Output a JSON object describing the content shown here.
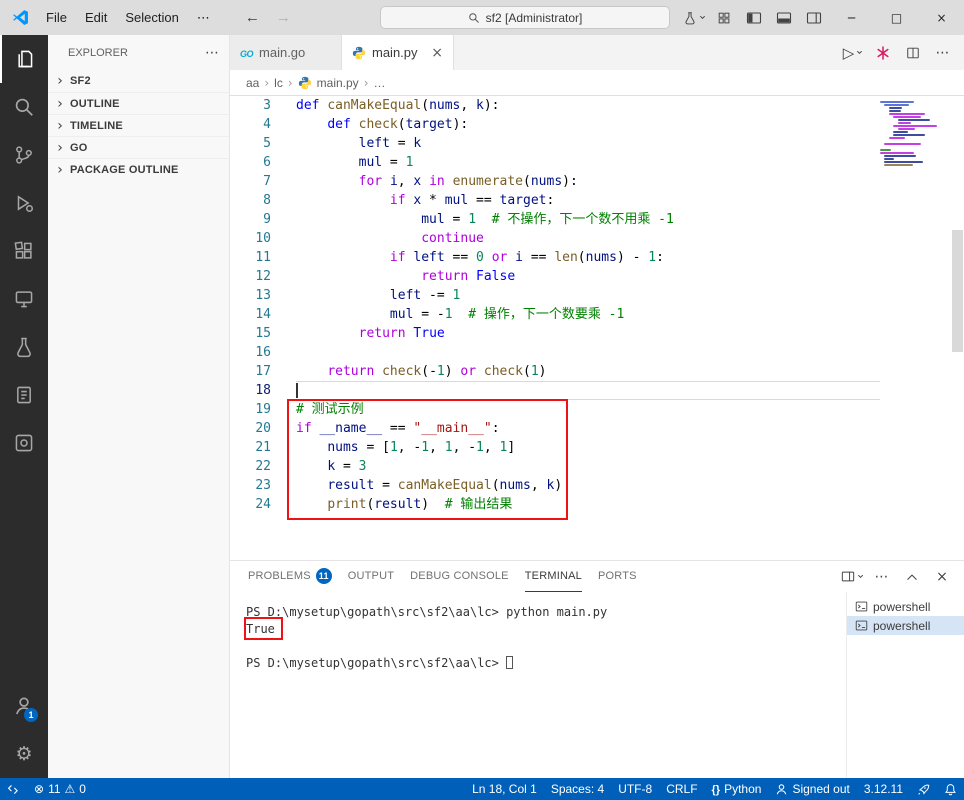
{
  "titlebar": {
    "menus": [
      "File",
      "Edit",
      "Selection"
    ],
    "menu_overflow": "⋯",
    "search_placeholder": "sf2 [Administrator]",
    "window_controls": {
      "minimize": "─",
      "maximize": "□",
      "close": "×"
    }
  },
  "activitybar": {
    "items": [
      "explorer",
      "search",
      "source-control",
      "run-debug",
      "extensions",
      "remote-explorer",
      "testing",
      "notebook",
      "tools"
    ],
    "active_item": "explorer",
    "account_badge": "1"
  },
  "sidebar": {
    "title": "EXPLORER",
    "sections": [
      "SF2",
      "OUTLINE",
      "TIMELINE",
      "GO",
      "PACKAGE OUTLINE"
    ]
  },
  "editor": {
    "tabs": [
      {
        "label": "main.go",
        "icon": "go",
        "active": false
      },
      {
        "label": "main.py",
        "icon": "python",
        "active": true
      }
    ],
    "breadcrumb": [
      "aa",
      "lc",
      "main.py",
      "…"
    ],
    "current_line": 18,
    "lines": [
      {
        "n": 3,
        "tokens": [
          [
            "kw",
            "def"
          ],
          [
            "pl",
            " "
          ],
          [
            "fn",
            "canMakeEqual"
          ],
          [
            "pl",
            "("
          ],
          [
            "var",
            "nums"
          ],
          [
            "pl",
            ", "
          ],
          [
            "var",
            "k"
          ],
          [
            "pl",
            "):"
          ]
        ]
      },
      {
        "n": 4,
        "tokens": [
          [
            "pl",
            "    "
          ],
          [
            "kw",
            "def"
          ],
          [
            "pl",
            " "
          ],
          [
            "fn",
            "check"
          ],
          [
            "pl",
            "("
          ],
          [
            "var",
            "target"
          ],
          [
            "pl",
            "):"
          ]
        ]
      },
      {
        "n": 5,
        "tokens": [
          [
            "pl",
            "        "
          ],
          [
            "var",
            "left"
          ],
          [
            "pl",
            " = "
          ],
          [
            "var",
            "k"
          ]
        ]
      },
      {
        "n": 6,
        "tokens": [
          [
            "pl",
            "        "
          ],
          [
            "var",
            "mul"
          ],
          [
            "pl",
            " = "
          ],
          [
            "num",
            "1"
          ]
        ]
      },
      {
        "n": 7,
        "tokens": [
          [
            "pl",
            "        "
          ],
          [
            "ctrl",
            "for"
          ],
          [
            "pl",
            " "
          ],
          [
            "var",
            "i"
          ],
          [
            "pl",
            ", "
          ],
          [
            "var",
            "x"
          ],
          [
            "pl",
            " "
          ],
          [
            "ctrl",
            "in"
          ],
          [
            "pl",
            " "
          ],
          [
            "fn",
            "enumerate"
          ],
          [
            "pl",
            "("
          ],
          [
            "var",
            "nums"
          ],
          [
            "pl",
            "):"
          ]
        ]
      },
      {
        "n": 8,
        "tokens": [
          [
            "pl",
            "            "
          ],
          [
            "ctrl",
            "if"
          ],
          [
            "pl",
            " "
          ],
          [
            "var",
            "x"
          ],
          [
            "pl",
            " * "
          ],
          [
            "var",
            "mul"
          ],
          [
            "pl",
            " == "
          ],
          [
            "var",
            "target"
          ],
          [
            "pl",
            ":"
          ]
        ]
      },
      {
        "n": 9,
        "tokens": [
          [
            "pl",
            "                "
          ],
          [
            "var",
            "mul"
          ],
          [
            "pl",
            " = "
          ],
          [
            "num",
            "1"
          ],
          [
            "pl",
            "  "
          ],
          [
            "cmt",
            "# 不操作，下一个数不用乘 -1"
          ]
        ]
      },
      {
        "n": 10,
        "tokens": [
          [
            "pl",
            "                "
          ],
          [
            "ctrl",
            "continue"
          ]
        ]
      },
      {
        "n": 11,
        "tokens": [
          [
            "pl",
            "            "
          ],
          [
            "ctrl",
            "if"
          ],
          [
            "pl",
            " "
          ],
          [
            "var",
            "left"
          ],
          [
            "pl",
            " == "
          ],
          [
            "num",
            "0"
          ],
          [
            "pl",
            " "
          ],
          [
            "ctrl",
            "or"
          ],
          [
            "pl",
            " "
          ],
          [
            "var",
            "i"
          ],
          [
            "pl",
            " == "
          ],
          [
            "fn",
            "len"
          ],
          [
            "pl",
            "("
          ],
          [
            "var",
            "nums"
          ],
          [
            "pl",
            ") - "
          ],
          [
            "num",
            "1"
          ],
          [
            "pl",
            ":"
          ]
        ]
      },
      {
        "n": 12,
        "tokens": [
          [
            "pl",
            "                "
          ],
          [
            "ctrl",
            "return"
          ],
          [
            "pl",
            " "
          ],
          [
            "kw",
            "False"
          ]
        ]
      },
      {
        "n": 13,
        "tokens": [
          [
            "pl",
            "            "
          ],
          [
            "var",
            "left"
          ],
          [
            "pl",
            " -= "
          ],
          [
            "num",
            "1"
          ]
        ]
      },
      {
        "n": 14,
        "tokens": [
          [
            "pl",
            "            "
          ],
          [
            "var",
            "mul"
          ],
          [
            "pl",
            " = -"
          ],
          [
            "num",
            "1"
          ],
          [
            "pl",
            "  "
          ],
          [
            "cmt",
            "# 操作，下一个数要乘 -1"
          ]
        ]
      },
      {
        "n": 15,
        "tokens": [
          [
            "pl",
            "        "
          ],
          [
            "ctrl",
            "return"
          ],
          [
            "pl",
            " "
          ],
          [
            "kw",
            "True"
          ]
        ]
      },
      {
        "n": 16,
        "tokens": []
      },
      {
        "n": 17,
        "tokens": [
          [
            "pl",
            "    "
          ],
          [
            "ctrl",
            "return"
          ],
          [
            "pl",
            " "
          ],
          [
            "fn",
            "check"
          ],
          [
            "pl",
            "(-"
          ],
          [
            "num",
            "1"
          ],
          [
            "pl",
            ") "
          ],
          [
            "ctrl",
            "or"
          ],
          [
            "pl",
            " "
          ],
          [
            "fn",
            "check"
          ],
          [
            "pl",
            "("
          ],
          [
            "num",
            "1"
          ],
          [
            "pl",
            ")"
          ]
        ]
      },
      {
        "n": 18,
        "tokens": []
      },
      {
        "n": 19,
        "tokens": [
          [
            "cmt",
            "# 测试示例"
          ]
        ]
      },
      {
        "n": 20,
        "tokens": [
          [
            "ctrl",
            "if"
          ],
          [
            "pl",
            " "
          ],
          [
            "var",
            "__name__"
          ],
          [
            "pl",
            " == "
          ],
          [
            "str",
            "\"__main__\""
          ],
          [
            "pl",
            ":"
          ]
        ]
      },
      {
        "n": 21,
        "tokens": [
          [
            "pl",
            "    "
          ],
          [
            "var",
            "nums"
          ],
          [
            "pl",
            " = ["
          ],
          [
            "num",
            "1"
          ],
          [
            "pl",
            ", -"
          ],
          [
            "num",
            "1"
          ],
          [
            "pl",
            ", "
          ],
          [
            "num",
            "1"
          ],
          [
            "pl",
            ", -"
          ],
          [
            "num",
            "1"
          ],
          [
            "pl",
            ", "
          ],
          [
            "num",
            "1"
          ],
          [
            "pl",
            "]"
          ]
        ]
      },
      {
        "n": 22,
        "tokens": [
          [
            "pl",
            "    "
          ],
          [
            "var",
            "k"
          ],
          [
            "pl",
            " = "
          ],
          [
            "num",
            "3"
          ]
        ]
      },
      {
        "n": 23,
        "tokens": [
          [
            "pl",
            "    "
          ],
          [
            "var",
            "result"
          ],
          [
            "pl",
            " = "
          ],
          [
            "fn",
            "canMakeEqual"
          ],
          [
            "pl",
            "("
          ],
          [
            "var",
            "nums"
          ],
          [
            "pl",
            ", "
          ],
          [
            "var",
            "k"
          ],
          [
            "pl",
            ")"
          ]
        ]
      },
      {
        "n": 24,
        "tokens": [
          [
            "pl",
            "    "
          ],
          [
            "fn",
            "print"
          ],
          [
            "pl",
            "("
          ],
          [
            "var",
            "result"
          ],
          [
            "pl",
            ")  "
          ],
          [
            "cmt",
            "# 输出结果"
          ]
        ]
      }
    ]
  },
  "panel": {
    "tabs": [
      {
        "label": "PROBLEMS",
        "badge": "11",
        "active": false
      },
      {
        "label": "OUTPUT",
        "active": false
      },
      {
        "label": "DEBUG CONSOLE",
        "active": false
      },
      {
        "label": "TERMINAL",
        "active": true
      },
      {
        "label": "PORTS",
        "active": false
      }
    ],
    "terminal_lines": [
      "PS D:\\mysetup\\gopath\\src\\sf2\\aa\\lc> python main.py",
      "True",
      "",
      "PS D:\\mysetup\\gopath\\src\\sf2\\aa\\lc> "
    ],
    "terminal_list": [
      {
        "label": "powershell",
        "selected": false
      },
      {
        "label": "powershell",
        "selected": true
      }
    ]
  },
  "statusbar": {
    "errors": "11",
    "warnings": "0",
    "items": [
      {
        "label": "Ln 18, Col 1",
        "icon": ""
      },
      {
        "label": "Spaces: 4",
        "icon": ""
      },
      {
        "label": "UTF-8",
        "icon": ""
      },
      {
        "label": "CRLF",
        "icon": ""
      },
      {
        "label": "Python",
        "icon": "braces"
      },
      {
        "label": "Signed out",
        "icon": "account"
      },
      {
        "label": "3.12.11",
        "icon": ""
      },
      {
        "label": "",
        "icon": "rocket"
      },
      {
        "label": "",
        "icon": "bell"
      }
    ]
  },
  "colors": {
    "statusbar": "#005fb8",
    "badge": "#0067c0",
    "annotation": "#ee1212",
    "keyword": "#0000ff",
    "control": "#af00db",
    "function": "#795e26",
    "variable": "#001080",
    "number": "#098658",
    "string": "#a31515",
    "comment": "#008000"
  }
}
